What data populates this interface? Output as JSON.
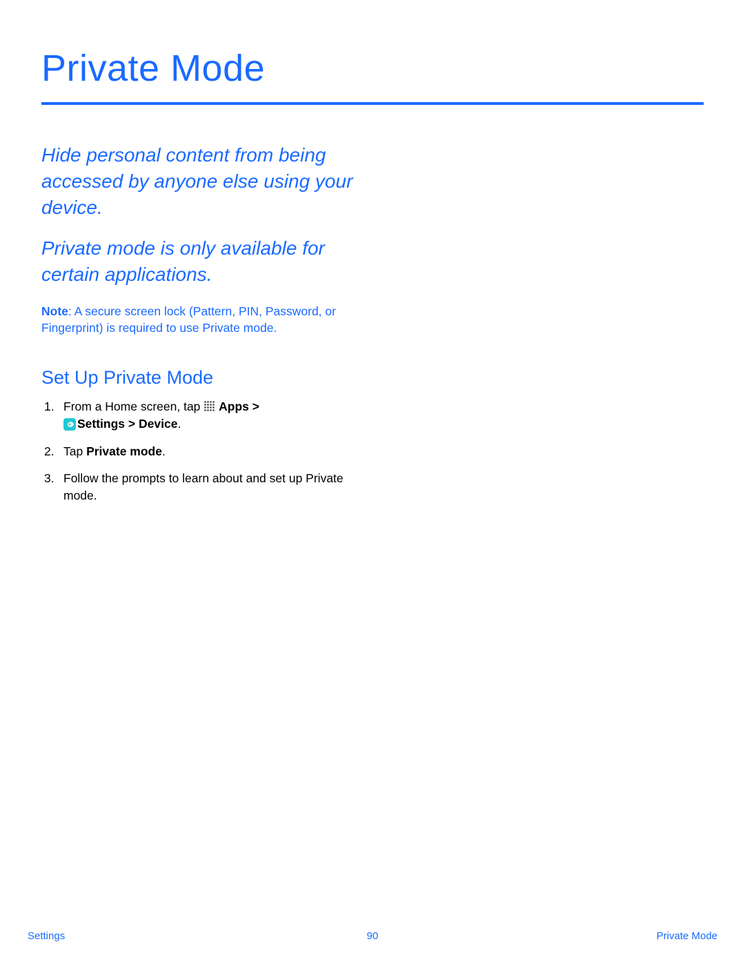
{
  "title": "Private Mode",
  "intro": {
    "p1": "Hide personal content from being accessed by anyone else using your device.",
    "p2": "Private mode is only available for certain applications."
  },
  "note": {
    "label": "Note",
    "text": ": A secure screen lock (Pattern, PIN, Password, or Fingerprint) is required to use Private mode."
  },
  "section_heading": "Set Up Private Mode",
  "steps": {
    "step1": {
      "pre": "From a Home screen, tap ",
      "apps": "Apps",
      "gt1": " > ",
      "settings": "Settings",
      "gt2": " > ",
      "device": "Device",
      "dot": "."
    },
    "step2": {
      "pre": "Tap ",
      "bold": "Private mode",
      "dot": "."
    },
    "step3": "Follow the prompts to learn about and set up Private mode."
  },
  "footer": {
    "left": "Settings",
    "center": "90",
    "right": "Private Mode"
  }
}
